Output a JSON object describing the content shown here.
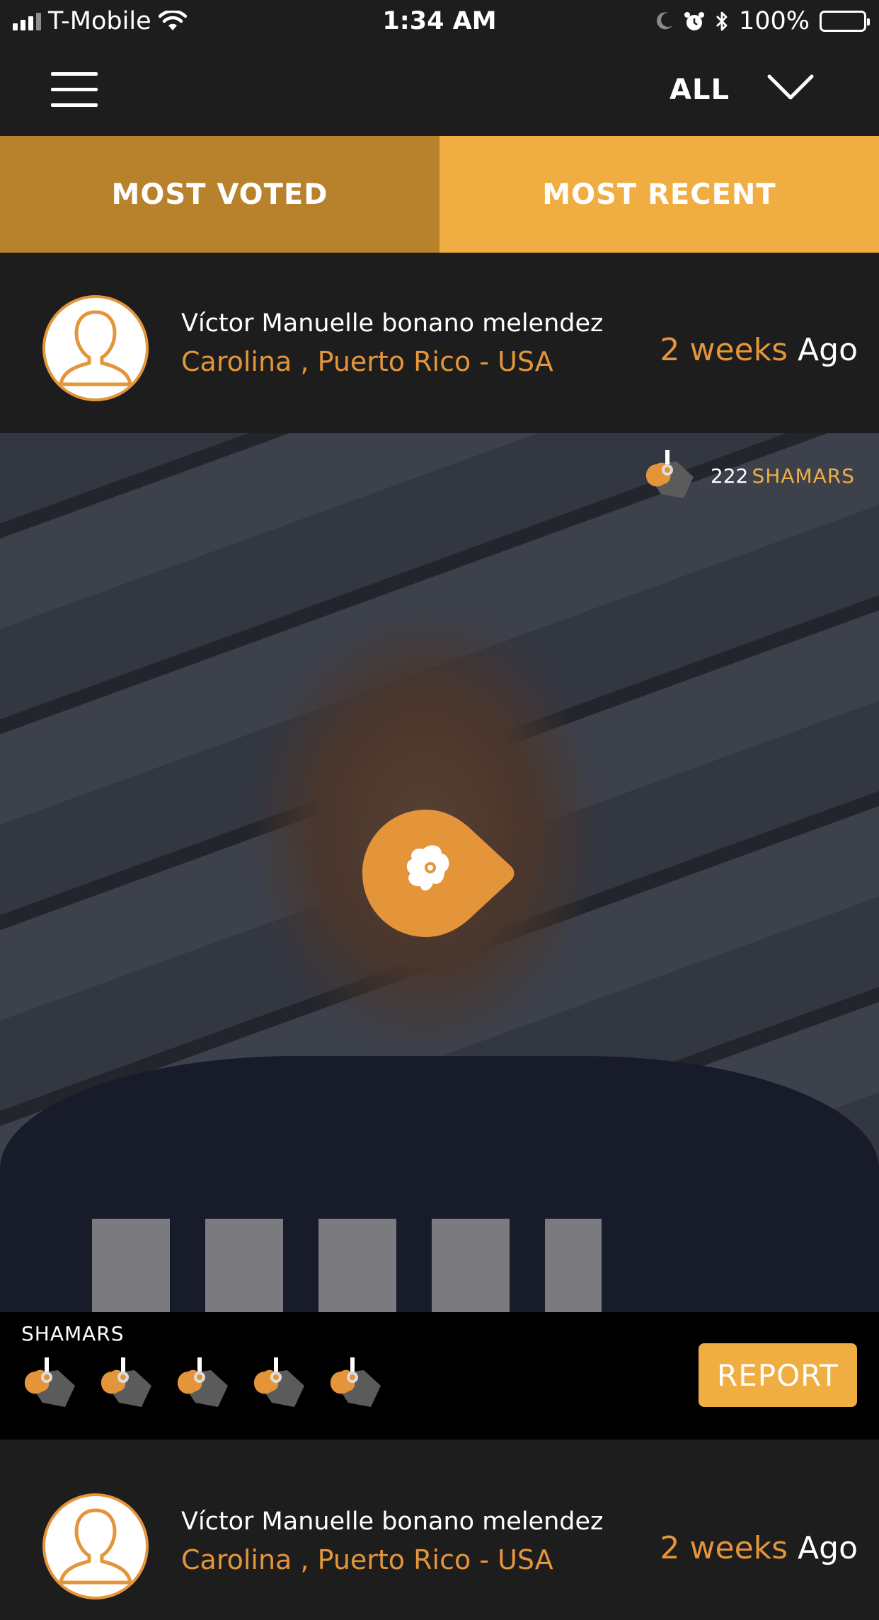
{
  "status_bar": {
    "carrier": "T-Mobile",
    "time": "1:34 AM",
    "battery": "100%"
  },
  "nav": {
    "filter_label": "ALL"
  },
  "tabs": [
    {
      "label": "MOST VOTED",
      "active": false
    },
    {
      "label": "MOST RECENT",
      "active": true
    }
  ],
  "posts": [
    {
      "author": "Víctor Manuelle  bonano melendez",
      "location": "Carolina , Puerto Rico - USA",
      "time_value": "2 weeks",
      "time_suffix": " Ago",
      "votes": "222",
      "votes_unit": "SHAMARS",
      "shamars_label": "SHAMARS",
      "report_label": "REPORT"
    },
    {
      "author": "Víctor Manuelle  bonano melendez",
      "location": "Carolina , Puerto Rico - USA",
      "time_value": "2 weeks",
      "time_suffix": " Ago"
    }
  ],
  "colors": {
    "background": "#1d1d1e",
    "accent": "#f0ad41",
    "accent_dark": "#b8822c",
    "orange_text": "#e4953a"
  },
  "icons": [
    "hamburger-menu-icon",
    "chevron-down-icon",
    "shamar-mascot-icon",
    "play-icon",
    "person-placeholder-icon"
  ]
}
